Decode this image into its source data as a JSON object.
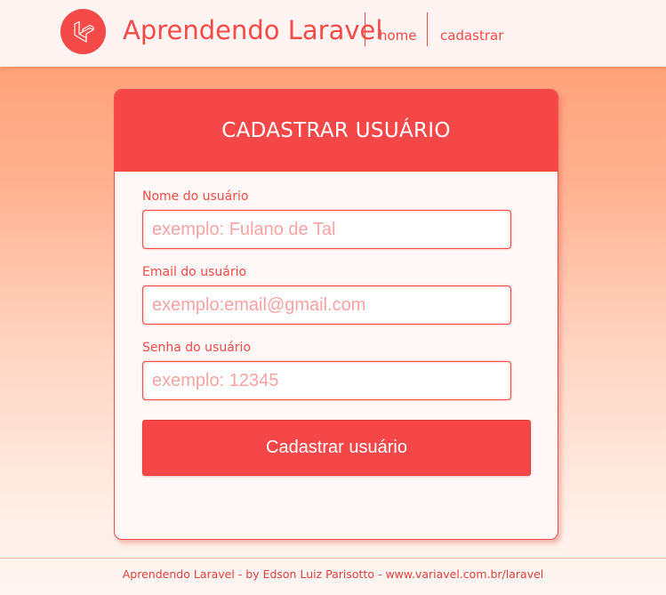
{
  "header": {
    "logo_icon": "laravel-logo-icon",
    "brand_title": "Aprendendo Laravel",
    "nav": [
      {
        "label": "home"
      },
      {
        "label": "cadastrar"
      }
    ]
  },
  "form": {
    "title": "CADASTRAR USUÁRIO",
    "fields": [
      {
        "label": "Nome do usuário",
        "placeholder": "exemplo: Fulano de Tal",
        "value": ""
      },
      {
        "label": "Email do usuário",
        "placeholder": "exemplo:email@gmail.com",
        "value": ""
      },
      {
        "label": "Senha do usuário",
        "placeholder": "exemplo: 12345",
        "value": ""
      }
    ],
    "submit_label": "Cadastrar usuário"
  },
  "footer": {
    "text": "Aprendendo Laravel - by Edson Luiz Parisotto - www.variavel.com.br/laravel"
  },
  "colors": {
    "accent": "#f54a48",
    "header_bg": "#fff4f1",
    "page_gradient_top": "#ff9a6e",
    "page_gradient_bottom": "#fff6f2"
  }
}
